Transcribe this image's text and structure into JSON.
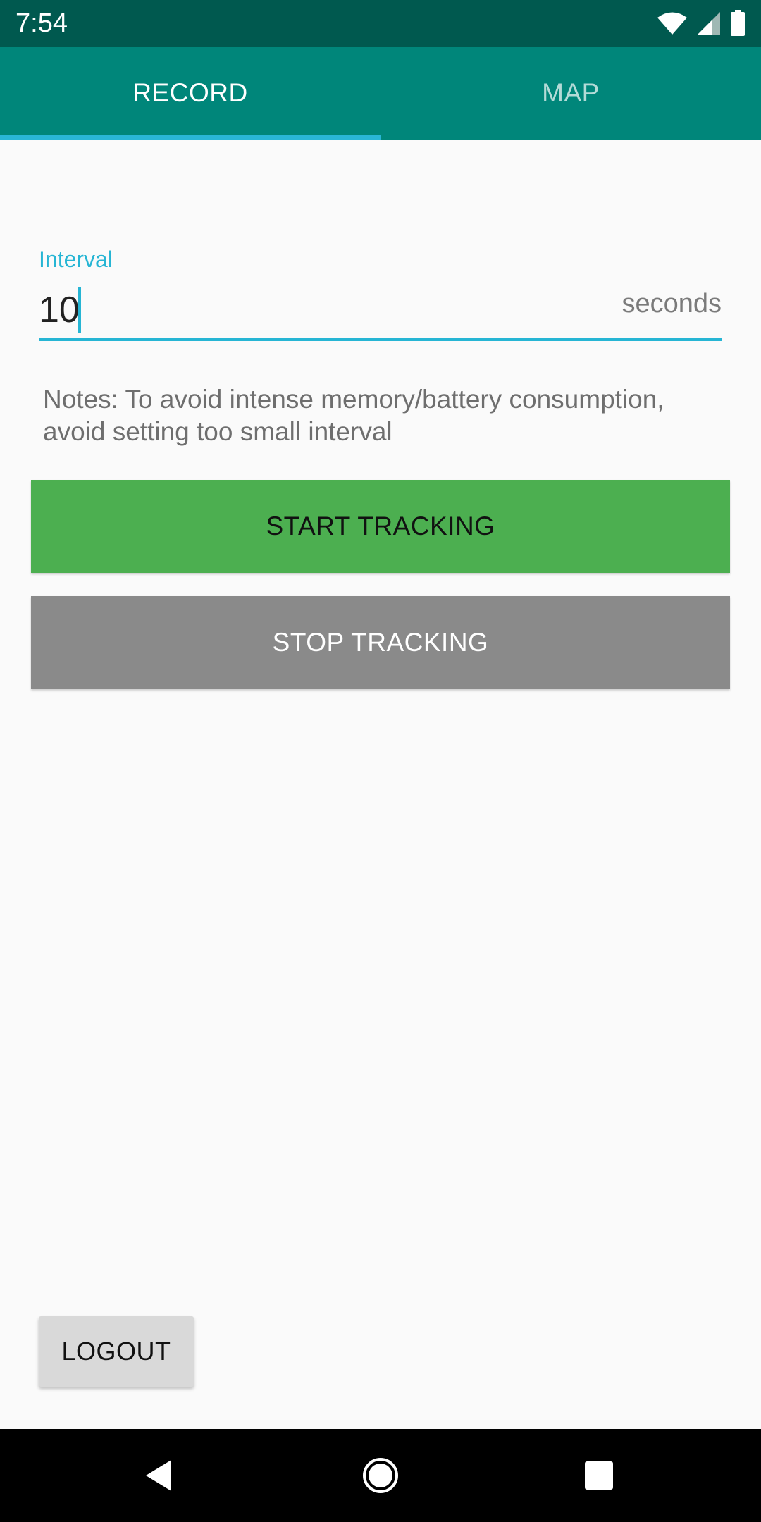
{
  "status_bar": {
    "time": "7:54",
    "icons": [
      "wifi-icon",
      "signal-icon",
      "battery-icon"
    ]
  },
  "tabs": [
    {
      "label": "RECORD",
      "selected": true
    },
    {
      "label": "MAP",
      "selected": false
    }
  ],
  "interval_field": {
    "label": "Interval",
    "value": "10",
    "suffix": "seconds"
  },
  "notes": "Notes: To avoid intense memory/battery consumption, avoid setting too small interval",
  "buttons": {
    "start": "START TRACKING",
    "stop": "STOP TRACKING",
    "logout": "LOGOUT"
  },
  "nav_bar": {
    "icons": [
      "back-icon",
      "home-icon",
      "recents-icon"
    ]
  },
  "colors": {
    "status_bar": "#00594F",
    "tab_bar": "#00867A",
    "accent": "#26B5D4",
    "start_button": "#4CAF50",
    "stop_button": "#8A8A8A",
    "logout_button": "#D9D9D9"
  }
}
